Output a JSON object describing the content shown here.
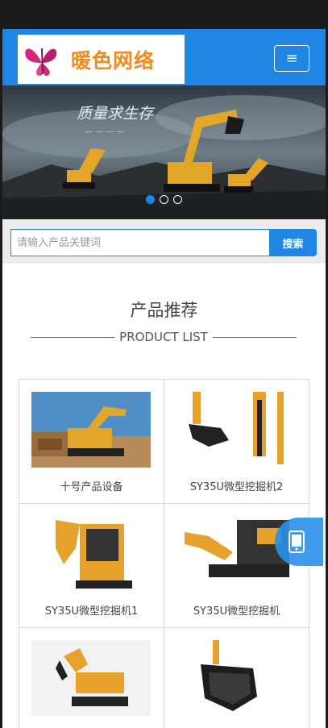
{
  "header": {
    "logo_text": "暖色网络",
    "menu_icon": "hamburger-icon",
    "brand_color": "#1f86e6"
  },
  "banner": {
    "title": "质量求生存",
    "subtitle": "— — — —",
    "slide_count": 3,
    "active_slide": 1
  },
  "search": {
    "placeholder": "请输入产品关键词",
    "button_label": "搜索"
  },
  "products": {
    "title": "产品推荐",
    "subtitle": "PRODUCT LIST",
    "items": [
      {
        "name": "十号产品设备"
      },
      {
        "name": "SY35U微型挖掘机2"
      },
      {
        "name": "SY35U微型挖掘机1"
      },
      {
        "name": "SY35U微型挖掘机"
      },
      {
        "name": ""
      },
      {
        "name": ""
      }
    ]
  },
  "float": {
    "icon": "mobile-phone-icon"
  }
}
